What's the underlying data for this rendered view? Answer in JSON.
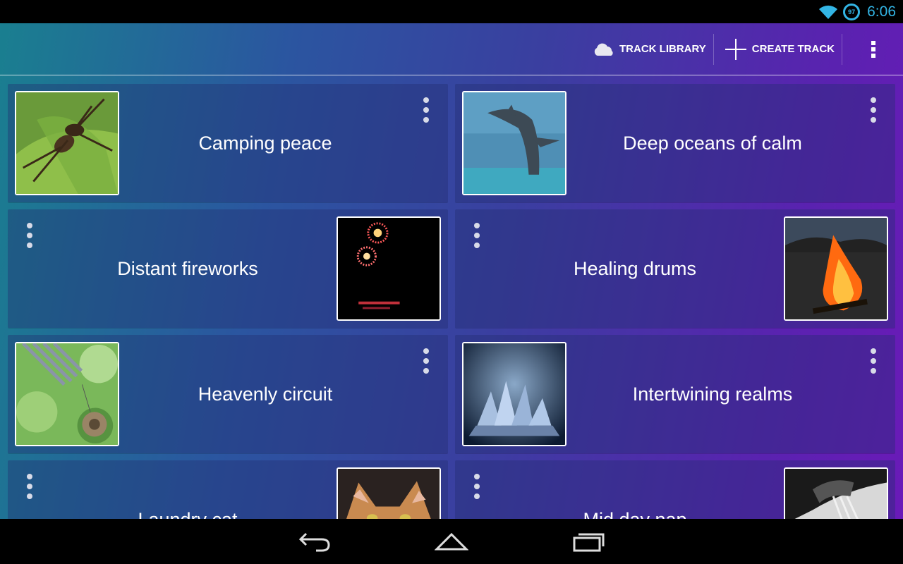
{
  "status_bar": {
    "time": "6:06",
    "battery_level": "97",
    "icons": [
      "wifi-icon",
      "battery-icon"
    ]
  },
  "action_bar": {
    "track_library_label": "TRACK LIBRARY",
    "create_track_label": "CREATE TRACK",
    "icons": [
      "cloud-icon",
      "plus-icon",
      "overflow-menu-icon"
    ]
  },
  "tracks": [
    {
      "title": "Camping peace",
      "image": "cricket-insect-image"
    },
    {
      "title": "Deep oceans of calm",
      "image": "dolphin-image"
    },
    {
      "title": "Distant fireworks",
      "image": "fireworks-image"
    },
    {
      "title": "Healing drums",
      "image": "campfire-image"
    },
    {
      "title": "Heavenly circuit",
      "image": "wind-chimes-image"
    },
    {
      "title": "Intertwining realms",
      "image": "crystals-image"
    },
    {
      "title": "Laundry cat",
      "image": "cat-image"
    },
    {
      "title": "Mid day nap",
      "image": "water-faucet-image"
    }
  ],
  "nav_bar": {
    "icons": [
      "back-icon",
      "home-icon",
      "recent-apps-icon"
    ]
  },
  "colors": {
    "accent": "#33b5e5",
    "gradient_left": "#1a7f90",
    "gradient_right": "#6a1ab8"
  }
}
